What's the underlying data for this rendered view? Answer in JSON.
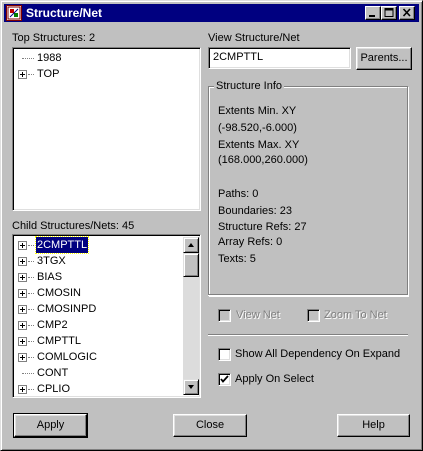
{
  "window": {
    "title": "Structure/Net",
    "icons": [
      "app-icon",
      "minimize-icon",
      "maximize-icon",
      "close-icon"
    ]
  },
  "top_structures": {
    "label": "Top Structures: 2",
    "items": [
      {
        "label": "1988",
        "expandable": false
      },
      {
        "label": "TOP",
        "expandable": true
      }
    ]
  },
  "child_structures": {
    "label": "Child Structures/Nets: 45",
    "items": [
      {
        "label": "2CMPTTL",
        "expandable": true,
        "selected": true
      },
      {
        "label": "3TGX",
        "expandable": true
      },
      {
        "label": "BIAS",
        "expandable": true
      },
      {
        "label": "CMOSIN",
        "expandable": true
      },
      {
        "label": "CMOSINPD",
        "expandable": true
      },
      {
        "label": "CMP2",
        "expandable": true
      },
      {
        "label": "CMPTTL",
        "expandable": true
      },
      {
        "label": "COMLOGIC",
        "expandable": true
      },
      {
        "label": "CONT",
        "expandable": false
      },
      {
        "label": "CPLIO",
        "expandable": true
      }
    ]
  },
  "view_structure": {
    "label": "View Structure/Net",
    "value": "2CMPTTL",
    "parents_button": "Parents..."
  },
  "structure_info": {
    "title": "Structure Info",
    "extents_min_label": "Extents Min. XY",
    "extents_min_value": "(-98.520,-6.000)",
    "extents_max_label": "Extents Max. XY",
    "extents_max_value": "(168.000,260.000)",
    "paths": "Paths: 0",
    "boundaries": "Boundaries: 23",
    "structure_refs": "Structure Refs: 27",
    "array_refs": "Array Refs: 0",
    "texts": "Texts: 5"
  },
  "options": {
    "view_net": {
      "label": "View Net",
      "checked": false,
      "enabled": false
    },
    "zoom_to_net": {
      "label": "Zoom To Net",
      "checked": false,
      "enabled": false
    },
    "show_all_dependency": {
      "label": "Show All Dependency On Expand",
      "checked": false,
      "enabled": true
    },
    "apply_on_select": {
      "label": "Apply On Select",
      "checked": true,
      "enabled": true
    }
  },
  "buttons": {
    "apply": "Apply",
    "close": "Close",
    "help": "Help"
  }
}
